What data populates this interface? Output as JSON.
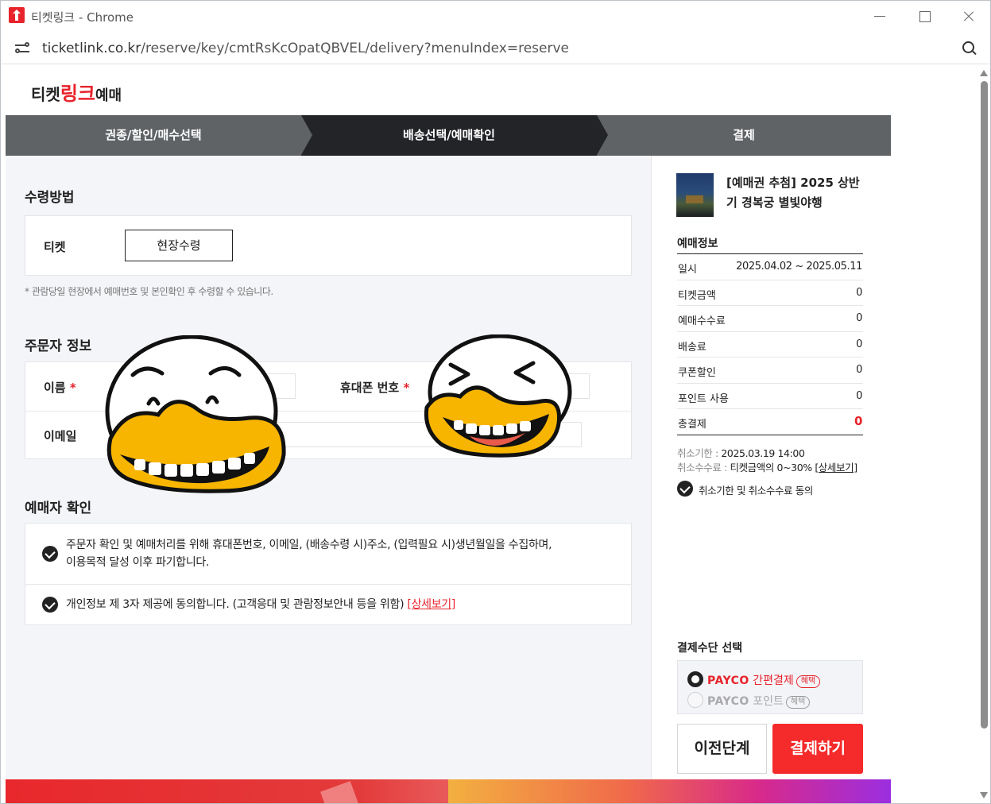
{
  "window": {
    "title": "티켓링크 - Chrome",
    "url_host": "ticketlink.co.kr",
    "url_path": "/reserve/key/cmtRsKcOpatQBVEL/delivery?menuIndex=reserve"
  },
  "logo": {
    "part1": "티켓",
    "part2": "링크",
    "part3": "예매"
  },
  "steps": [
    "권종/할인/매수선택",
    "배송선택/예매확인",
    "결제"
  ],
  "receive": {
    "title": "수령방법",
    "ticket_label": "티켓",
    "method": "현장수령",
    "note": "* 관람당일 현장에서 예매번호 및 본인확인 후 수령할 수 있습니다."
  },
  "orderer": {
    "title": "주문자 정보",
    "name_label": "이름",
    "phone_label": "휴대폰 번호",
    "email_label": "이메일",
    "required_mark": "*"
  },
  "confirm": {
    "title": "예매자 확인",
    "item1_line1": "주문자 확인 및 예매처리를 위해 휴대폰번호, 이메일, (배송수령 시)주소, (입력필요 시)생년월일을 수집하며,",
    "item1_line2": "이용목적 달성 이후 파기합니다.",
    "item2_text": "개인정보 제 3자 제공에 동의합니다. (고객응대 및 관람정보안내 등을 위함) ",
    "item2_link": "[상세보기]"
  },
  "side": {
    "product_title": "[예매권 추첨] 2025 상반기 경복궁 별빛야행",
    "info_title": "예매정보",
    "rows": [
      {
        "k": "일시",
        "v": "2025.04.02 ~ 2025.05.11"
      },
      {
        "k": "티켓금액",
        "v": "0"
      },
      {
        "k": "예매수수료",
        "v": "0"
      },
      {
        "k": "배송료",
        "v": "0"
      },
      {
        "k": "쿠폰할인",
        "v": "0"
      },
      {
        "k": "포인트 사용",
        "v": "0"
      }
    ],
    "total_label": "총결제",
    "total_value": "0",
    "cancel_deadline_k": "취소기한 : ",
    "cancel_deadline_v": "2025.03.19 14:00",
    "cancel_fee_k": "취소수수료 : ",
    "cancel_fee_v": "티켓금액의 0~30% ",
    "cancel_fee_link": "[상세보기]",
    "agree_text": "취소기한 및 취소수수료 동의",
    "pay_title": "결제수단 선택",
    "pay1_brand": "PAYCO",
    "pay1_name": " 간편결제",
    "pay2_brand": "PAYCO",
    "pay2_name": " 포인트",
    "badge": "혜택",
    "prev_btn": "이전단계",
    "pay_btn": "결제하기"
  },
  "colors": {
    "brand_red": "#e8232b",
    "pay_button": "#f52a2a",
    "step_active": "#232428",
    "step_inactive": "#5f6366"
  }
}
